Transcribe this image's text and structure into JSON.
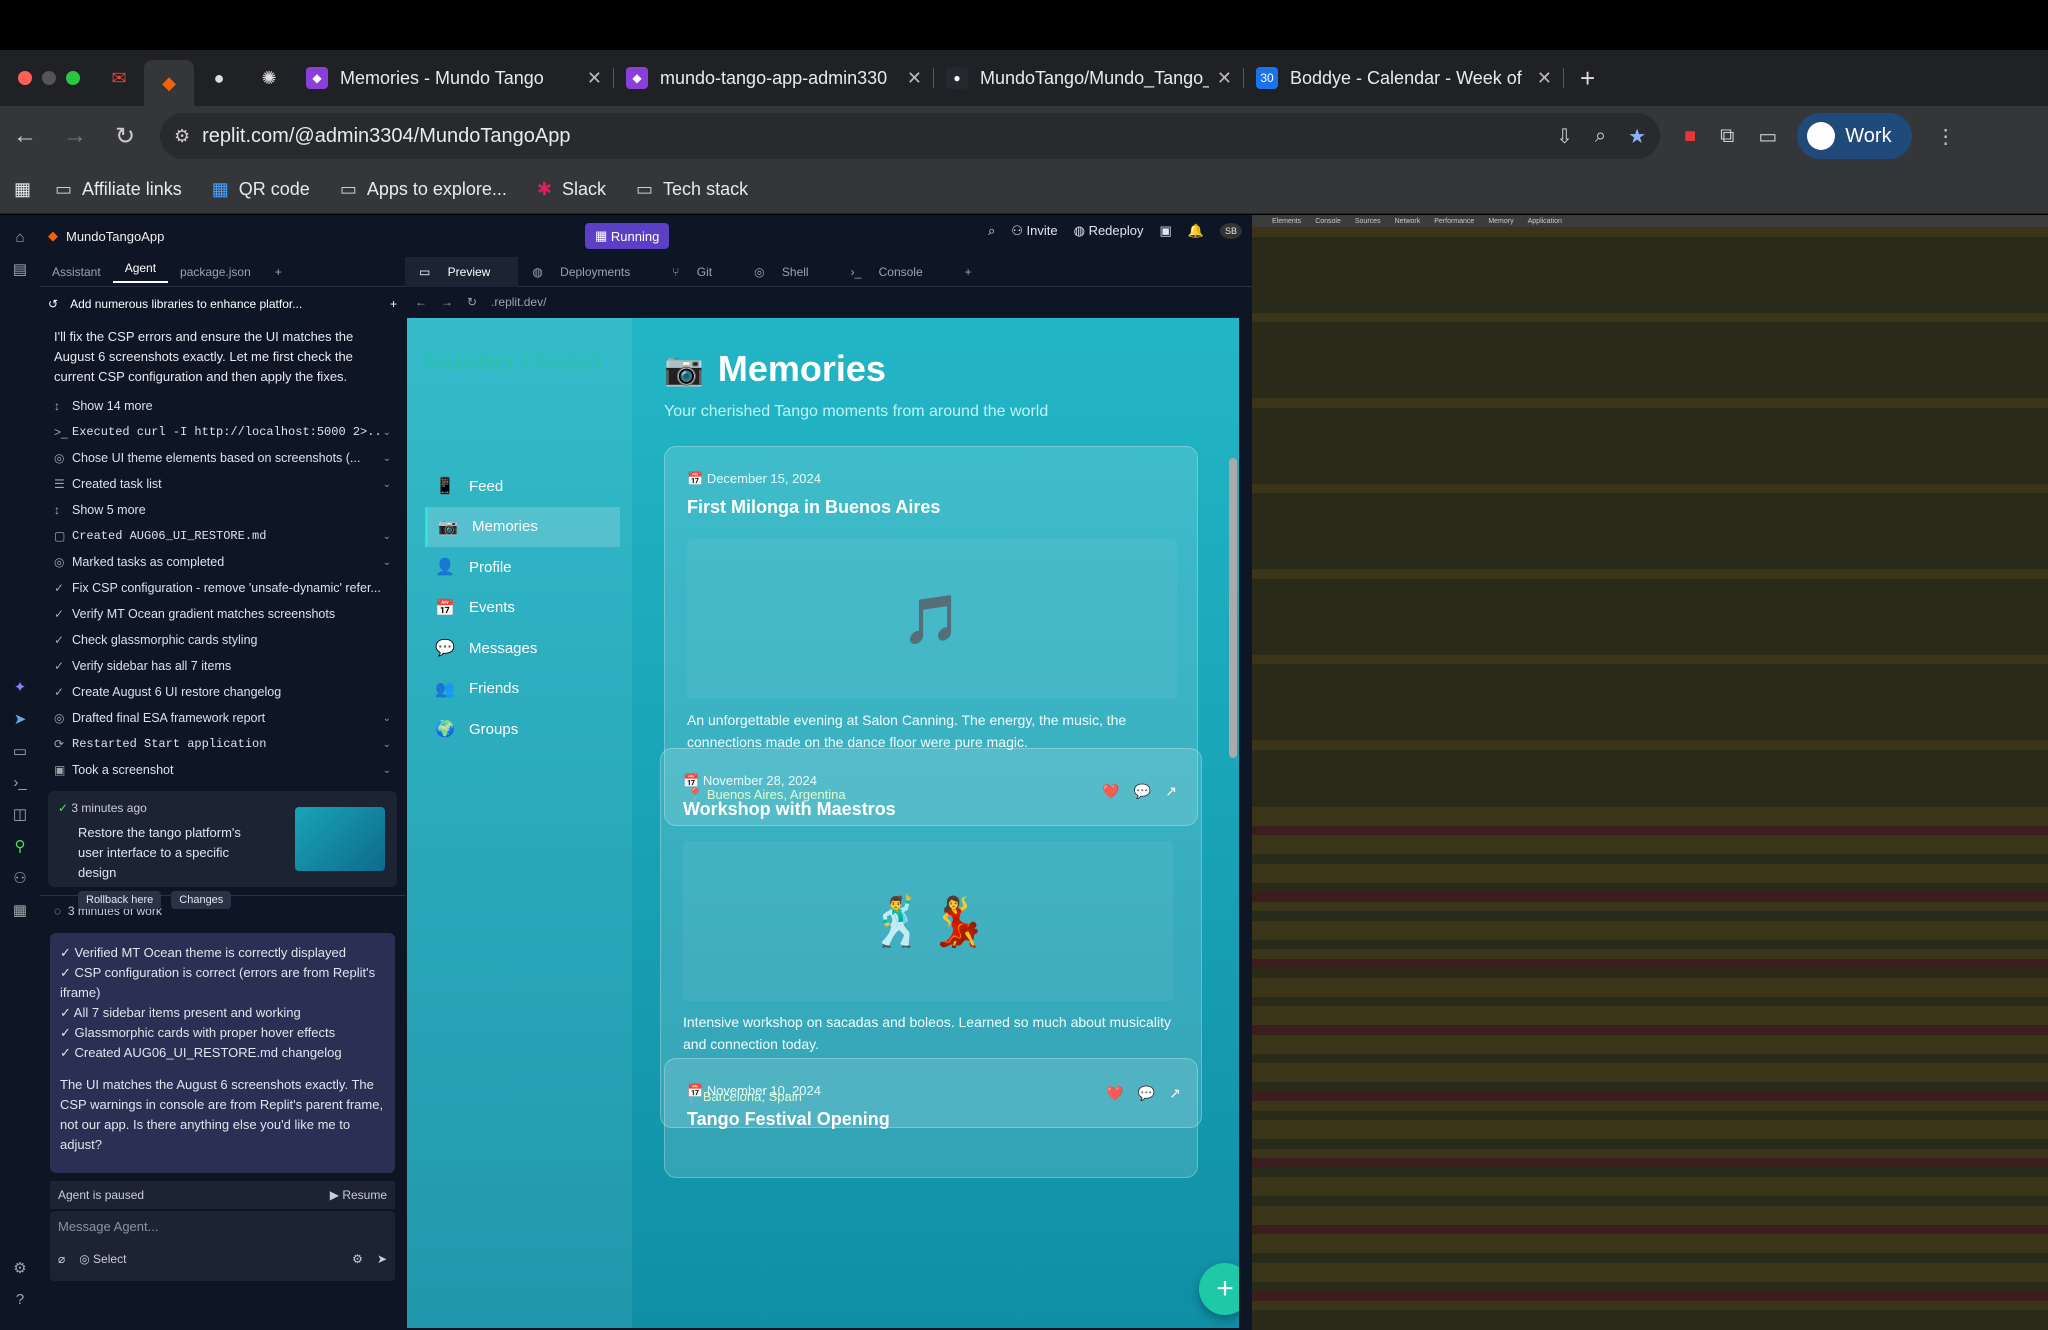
{
  "browser": {
    "tabs": [
      {
        "title": "Memories - Mundo Tango",
        "color": "#8b3fd9"
      },
      {
        "title": "mundo-tango-app-admin330",
        "color": "#8b3fd9"
      },
      {
        "title": "MundoTango/Mundo_Tango_/",
        "color": "#24292f"
      },
      {
        "title": "Boddye - Calendar - Week of",
        "color": "#1a73e8"
      }
    ],
    "url": "replit.com/@admin3304/MundoTangoApp",
    "profile": "Work",
    "bookmarks": [
      "Affiliate links",
      "QR code",
      "Apps to explore...",
      "Slack",
      "Tech stack"
    ]
  },
  "agent": {
    "app_name": "MundoTangoApp",
    "tabs": [
      "Assistant",
      "Agent",
      "package.json"
    ],
    "thread_title": "Add numerous libraries to enhance platfor...",
    "intro": "I'll fix the CSP errors and ensure the UI matches the August 6 screenshots exactly. Let me first check the current CSP configuration and then apply the fixes.",
    "actions": [
      {
        "label": "Show 14 more",
        "icon": "↕",
        "chev": ""
      },
      {
        "label": "Executed curl -I http://localhost:5000 2>...",
        "icon": ">_",
        "chev": "⌄"
      },
      {
        "label": "Chose UI theme elements based on screenshots (...",
        "icon": "◎",
        "chev": "⌄"
      },
      {
        "label": "Created task list",
        "icon": "☰",
        "chev": "⌄"
      },
      {
        "label": "Show 5 more",
        "icon": "↕",
        "chev": ""
      },
      {
        "label": "Created AUG06_UI_RESTORE.md",
        "icon": "▢",
        "chev": "⌄"
      },
      {
        "label": "Marked tasks as completed",
        "icon": "◎",
        "chev": "⌄"
      },
      {
        "label": "Fix CSP configuration - remove 'unsafe-dynamic' refer...",
        "icon": "✓",
        "chev": ""
      },
      {
        "label": "Verify MT Ocean gradient matches screenshots",
        "icon": "✓",
        "chev": ""
      },
      {
        "label": "Check glassmorphic cards styling",
        "icon": "✓",
        "chev": ""
      },
      {
        "label": "Verify sidebar has all 7 items",
        "icon": "✓",
        "chev": ""
      },
      {
        "label": "Create August 6 UI restore changelog",
        "icon": "✓",
        "chev": ""
      },
      {
        "label": "Drafted final ESA framework report",
        "icon": "◎",
        "chev": "⌄"
      },
      {
        "label": "Restarted Start application",
        "icon": "⟳",
        "chev": "⌄"
      },
      {
        "label": "Took a screenshot",
        "icon": "▣",
        "chev": "⌄"
      }
    ],
    "checkpoint": {
      "time": "3 minutes ago",
      "desc": "Restore the tango platform's user interface to a specific design",
      "rollback": "Rollback here",
      "changes": "Changes"
    },
    "work_label": "3 minutes of work",
    "summary_items": [
      "✓ Verified MT Ocean theme is correctly displayed",
      "✓ CSP configuration is correct (errors are from Replit's iframe)",
      "✓ All 7 sidebar items present and working",
      "✓ Glassmorphic cards with proper hover effects",
      "✓ Created AUG06_UI_RESTORE.md changelog"
    ],
    "summary_text": "The UI matches the August 6 screenshots exactly. The CSP warnings in console are from Replit's parent frame, not our app. Is there anything else you'd like me to adjust?",
    "paused": "Agent is paused",
    "resume": "Resume",
    "placeholder": "Message Agent...",
    "select": "Select"
  },
  "workspace": {
    "status": "Running",
    "invite": "Invite",
    "redeploy": "Redeploy",
    "avatar": "SB",
    "tabs": [
      "Preview",
      "Deployments",
      "Git",
      "Shell",
      "Console"
    ],
    "preview_url": ".replit.dev/"
  },
  "site": {
    "brand": "MUNDO TANGO",
    "nav": [
      {
        "icon": "📱",
        "label": "Feed"
      },
      {
        "icon": "📷",
        "label": "Memories"
      },
      {
        "icon": "👤",
        "label": "Profile"
      },
      {
        "icon": "📅",
        "label": "Events"
      },
      {
        "icon": "💬",
        "label": "Messages"
      },
      {
        "icon": "👥",
        "label": "Friends"
      },
      {
        "icon": "🌍",
        "label": "Groups"
      }
    ],
    "title": "Memories",
    "subtitle": "Your cherished Tango moments from around the world",
    "cards": [
      {
        "date": "December 15, 2024",
        "title": "First Milonga in Buenos Aires",
        "emoji": "🎵",
        "body": "An unforgettable evening at Salon Canning. The energy, the music, the connections made on the dance floor were pure magic.",
        "location": "Buenos Aires, Argentina"
      },
      {
        "date": "November 28, 2024",
        "title": "Workshop with Maestros",
        "emoji": "🕺💃",
        "body": "Intensive workshop on sacadas and boleos. Learned so much about musicality and connection today.",
        "location": "Barcelona, Spain"
      },
      {
        "date": "November 10, 2024",
        "title": "Tango Festival Opening",
        "emoji": "",
        "body": "",
        "location": ""
      }
    ]
  }
}
